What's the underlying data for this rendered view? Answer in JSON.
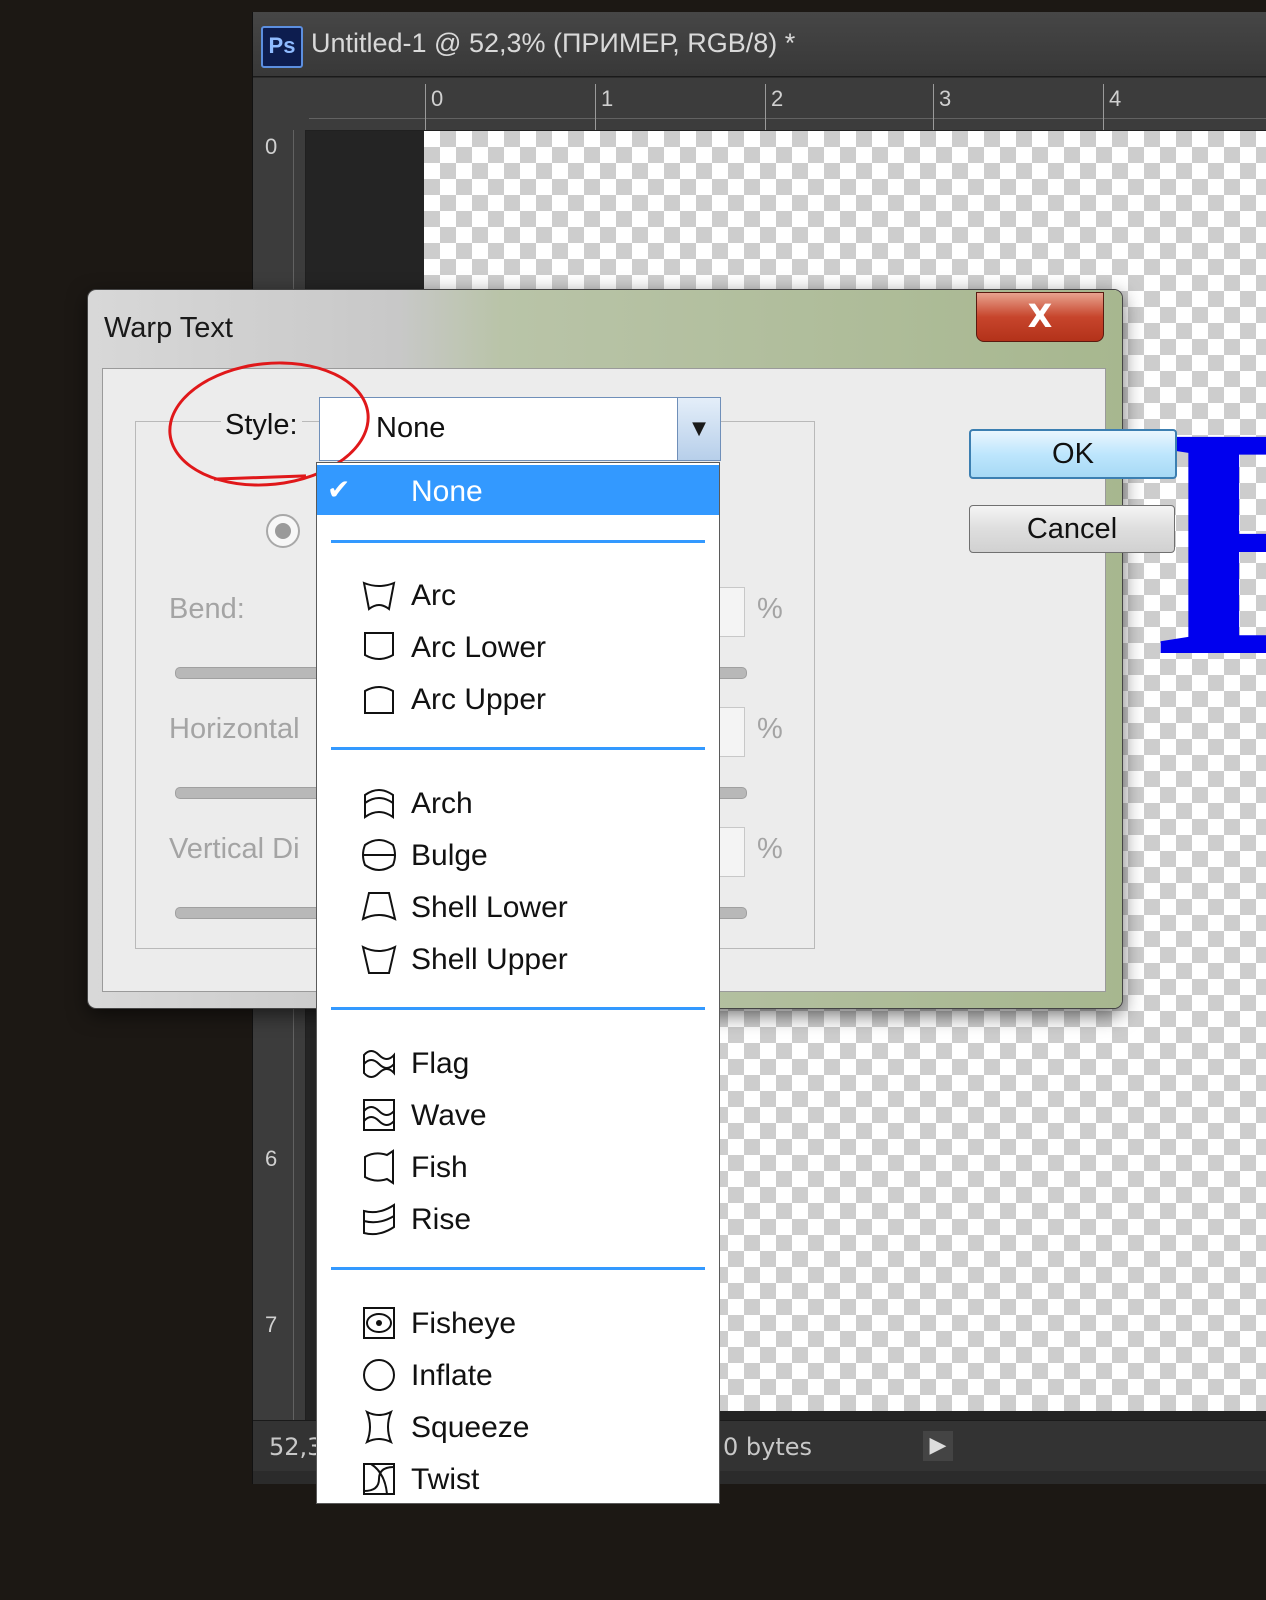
{
  "ps_window": {
    "logo": "Ps",
    "title": "Untitled-1 @ 52,3% (ПРИМЕР, RGB/8) *",
    "ruler_h_labels": [
      "0",
      "1",
      "2",
      "3",
      "4"
    ],
    "ruler_v_labels": [
      "0",
      "6",
      "7"
    ],
    "status_zoom": "52,3",
    "status_bytes": "0 bytes"
  },
  "dialog": {
    "title": "Warp Text",
    "close_label": "X",
    "style_label": "Style:",
    "style_value": "None",
    "bend_label": "Bend:",
    "horizontal_label": "Horizontal",
    "vertical_label": "Vertical Di",
    "percent": "%",
    "ok_label": "OK",
    "cancel_label": "Cancel"
  },
  "dropdown": {
    "selected": {
      "label": "None",
      "check": "✔"
    },
    "groups": [
      [
        {
          "label": "Arc",
          "icon": "arc-icon"
        },
        {
          "label": "Arc Lower",
          "icon": "arc-lower-icon"
        },
        {
          "label": "Arc Upper",
          "icon": "arc-upper-icon"
        }
      ],
      [
        {
          "label": "Arch",
          "icon": "arch-icon"
        },
        {
          "label": "Bulge",
          "icon": "bulge-icon"
        },
        {
          "label": "Shell Lower",
          "icon": "shell-lower-icon"
        },
        {
          "label": "Shell Upper",
          "icon": "shell-upper-icon"
        }
      ],
      [
        {
          "label": "Flag",
          "icon": "flag-icon"
        },
        {
          "label": "Wave",
          "icon": "wave-icon"
        },
        {
          "label": "Fish",
          "icon": "fish-icon"
        },
        {
          "label": "Rise",
          "icon": "rise-icon"
        }
      ],
      [
        {
          "label": "Fisheye",
          "icon": "fisheye-icon"
        },
        {
          "label": "Inflate",
          "icon": "inflate-icon"
        },
        {
          "label": "Squeeze",
          "icon": "squeeze-icon"
        },
        {
          "label": "Twist",
          "icon": "twist-icon"
        }
      ]
    ]
  },
  "colors": {
    "selection": "#3399ff",
    "annotation": "#e0181a",
    "canvas_text": "#0000ee"
  }
}
